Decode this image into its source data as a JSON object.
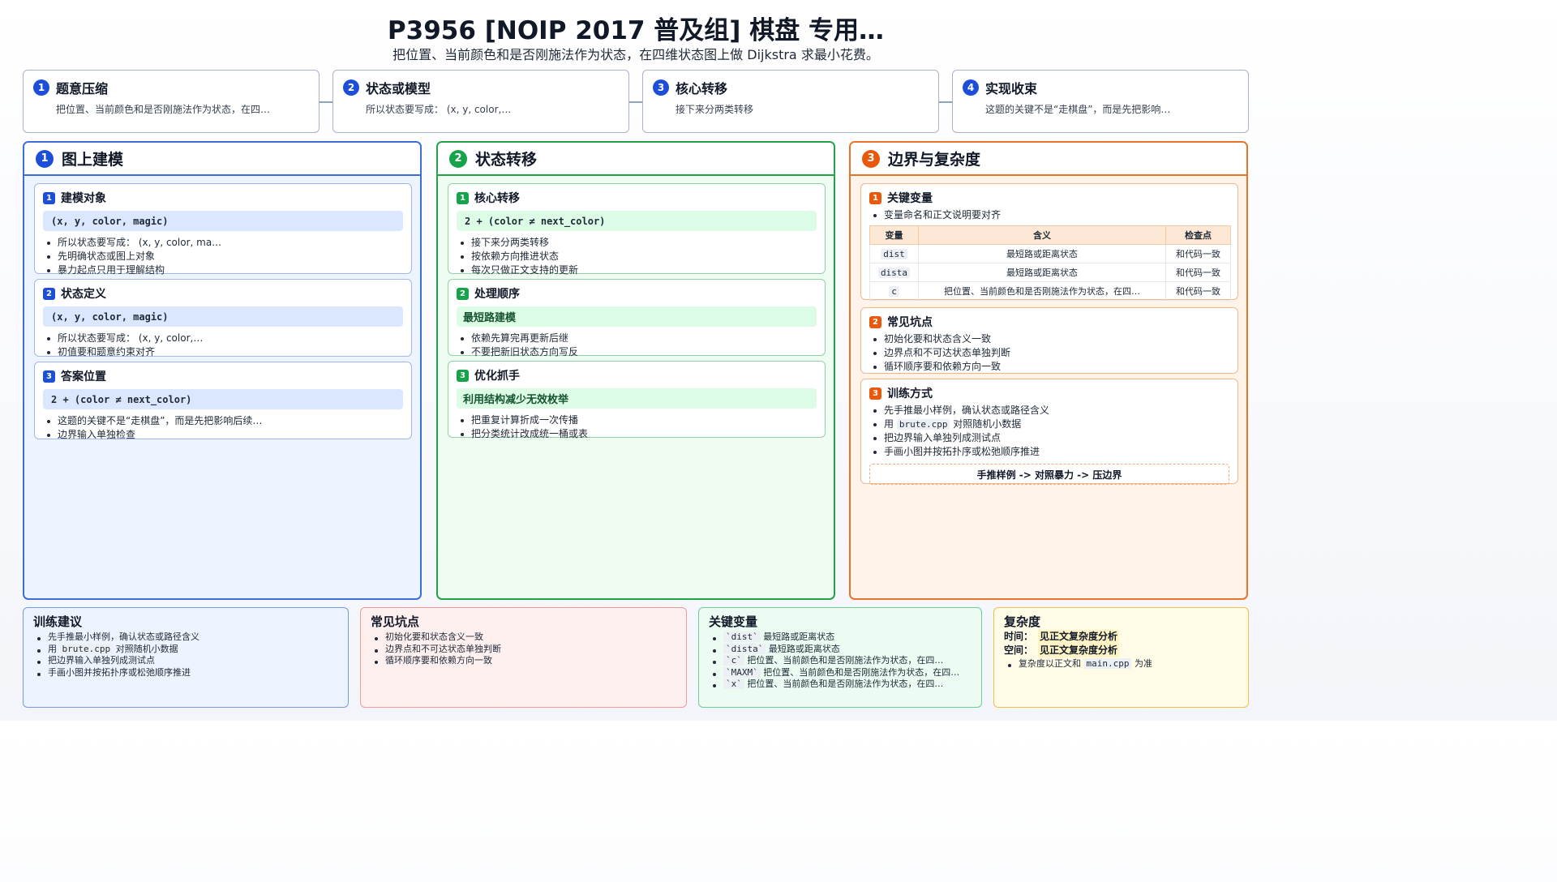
{
  "header": {
    "title": "P3956 [NOIP 2017 普及组] 棋盘 专用…",
    "subtitle": "把位置、当前颜色和是否刚施法作为状态，在四维状态图上做 Dijkstra 求最小花费。"
  },
  "steps": [
    {
      "num": "1",
      "title": "题意压缩",
      "desc": "把位置、当前颜色和是否刚施法作为状态，在四…"
    },
    {
      "num": "2",
      "title": "状态或模型",
      "desc": "所以状态要写成： (x, y, color,…"
    },
    {
      "num": "3",
      "title": "核心转移",
      "desc": "接下来分两类转移"
    },
    {
      "num": "4",
      "title": "实现收束",
      "desc": "这题的关键不是“走棋盘”，而是先把影响…"
    }
  ],
  "colors": {
    "blue": "#1d4ed8",
    "green": "#16a34a",
    "orange": "#ea580c"
  },
  "columns": {
    "modeling": {
      "num": "1",
      "title": "图上建模",
      "cards": [
        {
          "num": "1",
          "title": "建模对象",
          "code": "(x, y, color, magic)",
          "bullets": [
            "所以状态要写成： (x, y, color, ma…",
            "先明确状态或图上对象",
            "暴力起点只用于理解结构"
          ]
        },
        {
          "num": "2",
          "title": "状态定义",
          "code": "(x, y, color, magic)",
          "bullets": [
            "所以状态要写成： (x, y, color,…",
            "初值要和题意约束对齐"
          ]
        },
        {
          "num": "3",
          "title": "答案位置",
          "code": "2 + (color ≠ next_color)",
          "bullets": [
            "这题的关键不是“走棋盘”，而是先把影响后续…",
            "边界输入单独检查"
          ]
        }
      ]
    },
    "transition": {
      "num": "2",
      "title": "状态转移",
      "cards": [
        {
          "num": "1",
          "title": "核心转移",
          "code": "2 + (color ≠ next_color)",
          "bullets": [
            "接下来分两类转移",
            "按依赖方向推进状态",
            "每次只做正文支持的更新"
          ]
        },
        {
          "num": "2",
          "title": "处理顺序",
          "sub": "最短路建模",
          "bullets": [
            "依赖先算完再更新后继",
            "不要把新旧状态方向写反"
          ]
        },
        {
          "num": "3",
          "title": "优化抓手",
          "sub": "利用结构减少无效枚举",
          "bullets": [
            "把重复计算折成一次传播",
            "把分类统计改成统一桶或表"
          ]
        }
      ]
    },
    "boundary": {
      "num": "3",
      "title": "边界与复杂度",
      "vars_card": {
        "num": "1",
        "title": "关键变量",
        "note": "变量命名和正文说明要对齐",
        "table_headers": [
          "变量",
          "含义",
          "检查点"
        ],
        "rows": [
          {
            "var": "dist",
            "meaning": "最短路或距离状态",
            "check": "和代码一致"
          },
          {
            "var": "dista",
            "meaning": "最短路或距离状态",
            "check": "和代码一致"
          },
          {
            "var": "c",
            "meaning": "把位置、当前颜色和是否刚施法作为状态，在四…",
            "check": "和代码一致"
          }
        ]
      },
      "pitfalls_card": {
        "num": "2",
        "title": "常见坑点",
        "bullets": [
          "初始化要和状态含义一致",
          "边界点和不可达状态单独判断",
          "循环顺序要和依赖方向一致"
        ]
      },
      "train_card": {
        "num": "3",
        "title": "训练方式",
        "b1": "先手推最小样例，确认状态或路径含义",
        "b2_pre": "用",
        "b2_code": "brute.cpp",
        "b2_post": "对照随机小数据",
        "b3": "把边界输入单独列成测试点",
        "b4": "手画小图并按拓扑序或松弛顺序推进",
        "flow": "手推样例 -> 对照暴力 -> 压边界"
      }
    }
  },
  "bottom": {
    "training": {
      "title": "训练建议",
      "b1": "先手推最小样例，确认状态或路径含义",
      "b2_pre": "用",
      "b2_code": "brute.cpp",
      "b2_post": "对照随机小数据",
      "b3": "把边界输入单独列成测试点",
      "b4": "手画小图并按拓扑序或松弛顺序推进"
    },
    "pitfalls": {
      "title": "常见坑点",
      "bullets": [
        "初始化要和状态含义一致",
        "边界点和不可达状态单独判断",
        "循环顺序要和依赖方向一致"
      ]
    },
    "vars": {
      "title": "关键变量",
      "items": [
        {
          "code": "`dist`",
          "text": "最短路或距离状态"
        },
        {
          "code": "`dista`",
          "text": "最短路或距离状态"
        },
        {
          "code": "`c`",
          "text": "把位置、当前颜色和是否刚施法作为状态，在四…"
        },
        {
          "code": "`MAXM`",
          "text": "把位置、当前颜色和是否刚施法作为状态，在四…"
        },
        {
          "code": "`x`",
          "text": "把位置、当前颜色和是否刚施法作为状态，在四…"
        }
      ]
    },
    "complexity": {
      "title": "复杂度",
      "time_label": "时间：",
      "time_value": "见正文复杂度分析",
      "space_label": "空间：",
      "space_value": "见正文复杂度分析",
      "note_pre": "复杂度以正文和",
      "note_code": "main.cpp",
      "note_post": "为准"
    }
  }
}
